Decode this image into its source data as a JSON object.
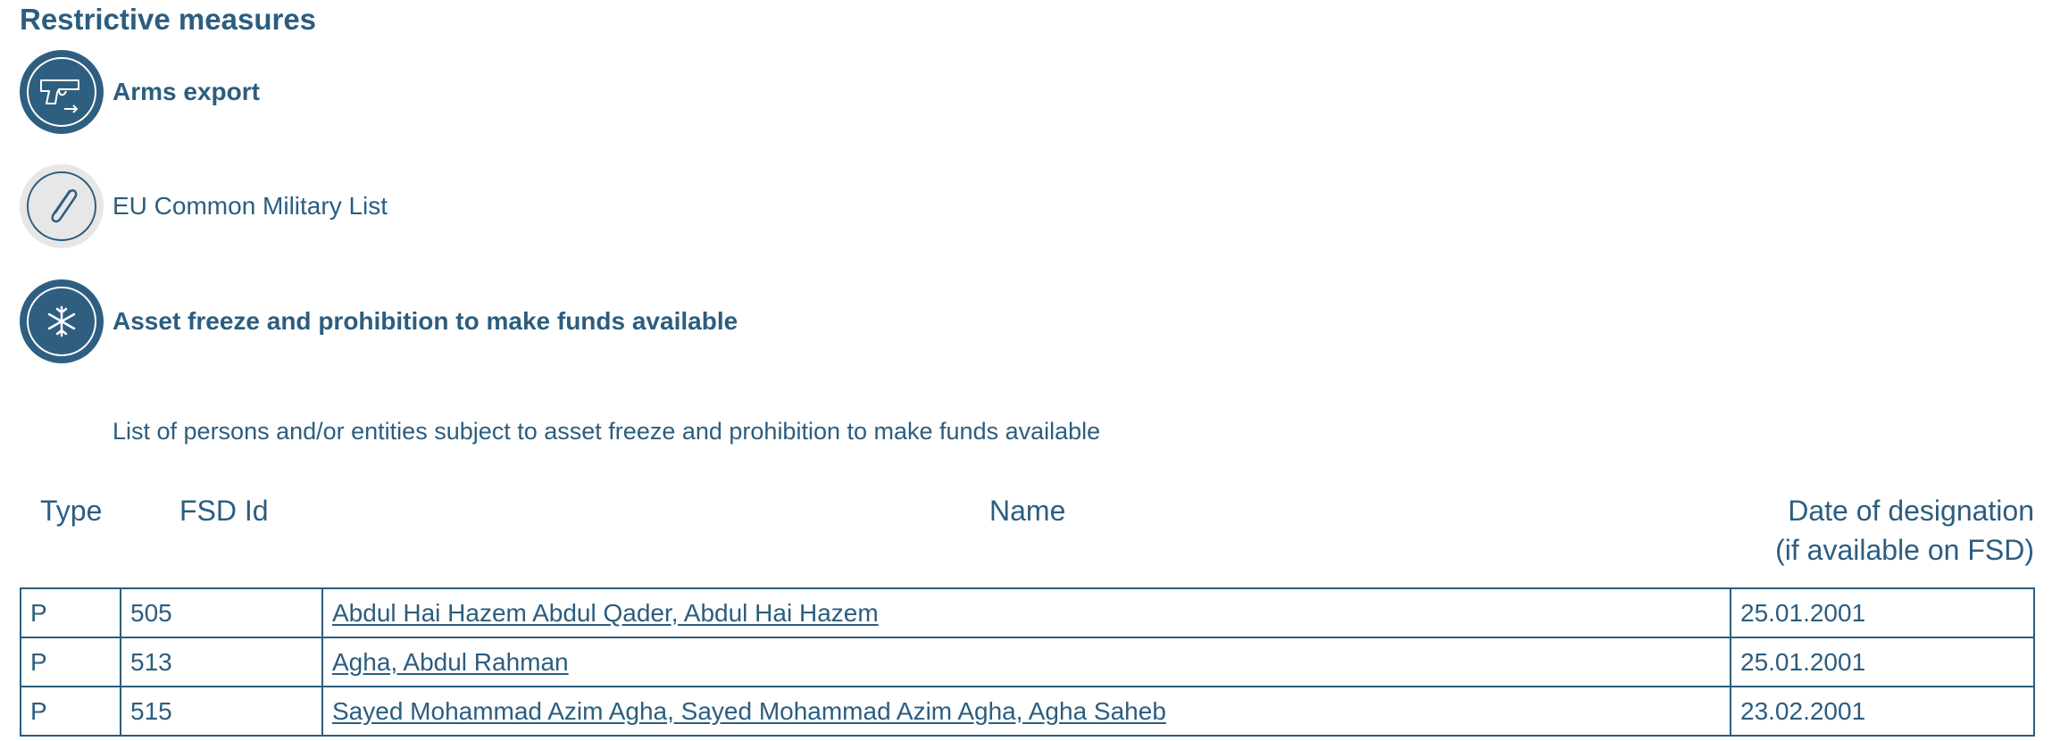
{
  "section": {
    "title": "Restrictive measures"
  },
  "measures": [
    {
      "label": "Arms export",
      "icon": "pistol-arrow-icon",
      "style": "dark",
      "bold": true
    },
    {
      "label": "EU Common Military List",
      "icon": "paperclip-icon",
      "style": "light",
      "bold": false
    },
    {
      "label": "Asset freeze and prohibition to make funds available",
      "icon": "snowflake-icon",
      "style": "dark",
      "bold": true
    }
  ],
  "list": {
    "description": "List of persons and/or entities subject to asset freeze and prohibition to make funds available",
    "headers": {
      "type": "Type",
      "fsd_id": "FSD Id",
      "name": "Name",
      "date_line1": "Date of designation",
      "date_line2": "(if available on FSD)"
    },
    "rows": [
      {
        "type": "P",
        "fsd_id": "505",
        "name": "Abdul Hai Hazem Abdul Qader, Abdul Hai Hazem",
        "date": "25.01.2001"
      },
      {
        "type": "P",
        "fsd_id": "513",
        "name": "Agha, Abdul Rahman",
        "date": "25.01.2001"
      },
      {
        "type": "P",
        "fsd_id": "515",
        "name": "Sayed Mohammad Azim Agha, Sayed Mohammad Azim Agha, Agha Saheb",
        "date": "23.02.2001"
      }
    ]
  },
  "colors": {
    "primary": "#2c5d7f",
    "icon_dark_bg": "#2f5f80",
    "icon_light_bg": "#e7e7e7"
  }
}
